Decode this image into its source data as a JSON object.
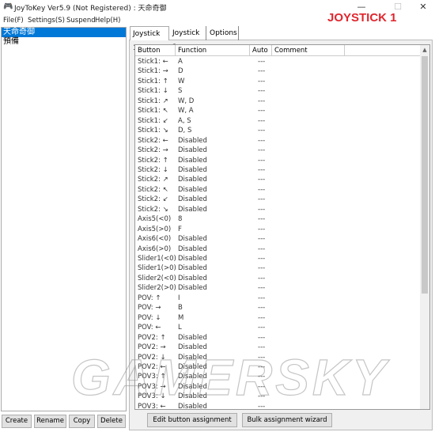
{
  "window": {
    "title": "JoyToKey Ver5.9 (Not Registered) : 天命奇御",
    "minimize": "—",
    "maximize": "☐",
    "close": "✕"
  },
  "menu": [
    "File(F)",
    "Settings(S)",
    "Suspend",
    "Help(H)"
  ],
  "overlay_label": "JOYSTICK 1",
  "watermark": "GAMERSKY",
  "profiles": [
    {
      "name": "天命奇御",
      "selected": true
    },
    {
      "name": "預備",
      "selected": false
    }
  ],
  "profile_buttons": [
    "Create",
    "Rename",
    "Copy",
    "Delete"
  ],
  "tabs": [
    {
      "label": "Joystick 1",
      "active": true
    },
    {
      "label": "Joystick 2",
      "active": false
    },
    {
      "label": "Options",
      "active": false
    }
  ],
  "table": {
    "columns": [
      "Button",
      "Function",
      "Auto",
      "Comment"
    ],
    "rows": [
      [
        "Stick1: ←",
        "A",
        "---",
        ""
      ],
      [
        "Stick1: →",
        "D",
        "---",
        ""
      ],
      [
        "Stick1: ↑",
        "W",
        "---",
        ""
      ],
      [
        "Stick1: ↓",
        "S",
        "---",
        ""
      ],
      [
        "Stick1: ↗",
        "W, D",
        "---",
        ""
      ],
      [
        "Stick1: ↖",
        "W, A",
        "---",
        ""
      ],
      [
        "Stick1: ↙",
        "A, S",
        "---",
        ""
      ],
      [
        "Stick1: ↘",
        "D, S",
        "---",
        ""
      ],
      [
        "Stick2: ←",
        "Disabled",
        "---",
        ""
      ],
      [
        "Stick2: →",
        "Disabled",
        "---",
        ""
      ],
      [
        "Stick2: ↑",
        "Disabled",
        "---",
        ""
      ],
      [
        "Stick2: ↓",
        "Disabled",
        "---",
        ""
      ],
      [
        "Stick2: ↗",
        "Disabled",
        "---",
        ""
      ],
      [
        "Stick2: ↖",
        "Disabled",
        "---",
        ""
      ],
      [
        "Stick2: ↙",
        "Disabled",
        "---",
        ""
      ],
      [
        "Stick2: ↘",
        "Disabled",
        "---",
        ""
      ],
      [
        "Axis5(<0)",
        "8",
        "---",
        ""
      ],
      [
        "Axis5(>0)",
        "F",
        "---",
        ""
      ],
      [
        "Axis6(<0)",
        "Disabled",
        "---",
        ""
      ],
      [
        "Axis6(>0)",
        "Disabled",
        "---",
        ""
      ],
      [
        "Slider1(<0)",
        "Disabled",
        "---",
        ""
      ],
      [
        "Slider1(>0)",
        "Disabled",
        "---",
        ""
      ],
      [
        "Slider2(<0)",
        "Disabled",
        "---",
        ""
      ],
      [
        "Slider2(>0)",
        "Disabled",
        "---",
        ""
      ],
      [
        "POV: ↑",
        "I",
        "---",
        ""
      ],
      [
        "POV: →",
        "B",
        "---",
        ""
      ],
      [
        "POV: ↓",
        "M",
        "---",
        ""
      ],
      [
        "POV: ←",
        "L",
        "---",
        ""
      ],
      [
        "POV2: ↑",
        "Disabled",
        "---",
        ""
      ],
      [
        "POV2: →",
        "Disabled",
        "---",
        ""
      ],
      [
        "POV2: ↓",
        "Disabled",
        "---",
        ""
      ],
      [
        "POV2: ←",
        "Disabled",
        "---",
        ""
      ],
      [
        "POV3: ↑",
        "Disabled",
        "---",
        ""
      ],
      [
        "POV3: →",
        "Disabled",
        "---",
        ""
      ],
      [
        "POV3: ↓",
        "Disabled",
        "---",
        ""
      ],
      [
        "POV3: ←",
        "Disabled",
        "---",
        ""
      ]
    ]
  },
  "buttons": {
    "edit": "Edit button assignment",
    "bulk": "Bulk assignment wizard"
  }
}
